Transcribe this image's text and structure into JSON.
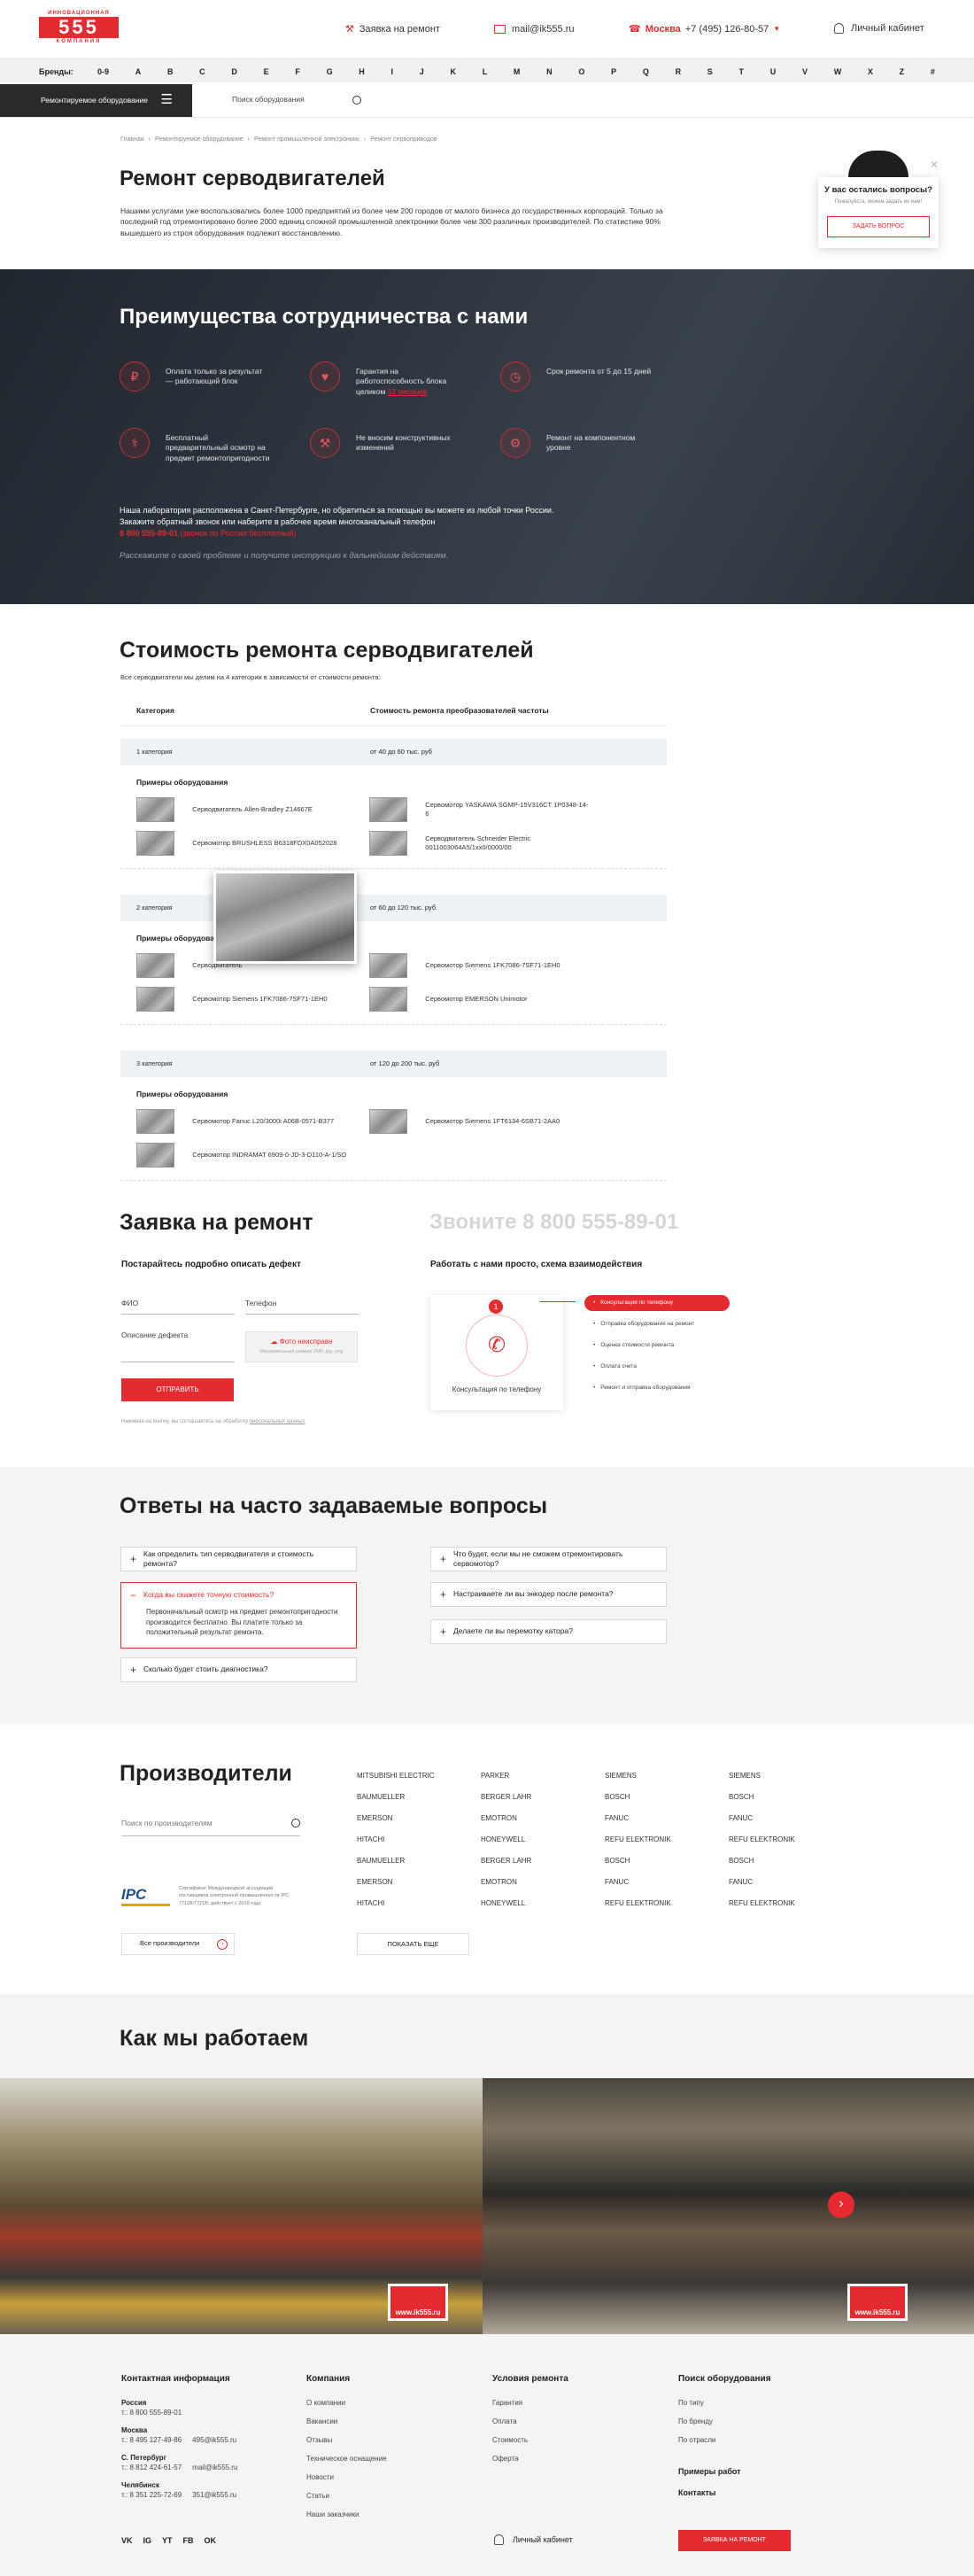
{
  "header": {
    "logo_top": "ИННОВАЦИОННАЯ",
    "logo_num": "555",
    "logo_bottom": "КОМПАНИЯ",
    "repair_link": "Заявка на ремонт",
    "email": "mail@ik555.ru",
    "city": "Москва",
    "phone": "+7 (495) 126-80-57",
    "cabinet": "Личный кабинет"
  },
  "brands": {
    "label": "Бренды:",
    "letters": [
      "0-9",
      "A",
      "B",
      "C",
      "D",
      "E",
      "F",
      "G",
      "H",
      "I",
      "J",
      "K",
      "L",
      "M",
      "N",
      "O",
      "P",
      "Q",
      "R",
      "S",
      "T",
      "U",
      "V",
      "W",
      "X",
      "Z",
      "#"
    ]
  },
  "nav": {
    "catalog": "Ремонтируемое оборудование",
    "search_placeholder": "Поиск оборудования"
  },
  "breadcrumbs": [
    "Главная",
    "Ремонтируемое оборудование",
    "Ремонт промышленной электроники",
    "Ремонт сервоприводов"
  ],
  "hero": {
    "title": "Ремонт серводвигателей",
    "text": "Нашими услугами уже воспользовались более 1000 предприятий из более чем 200 городов от малого бизнеса до государственных корпораций. Только за последний год отремонтировано более 2000 единиц сложной промышленной электроники более чем 300 различных производителей. По статистике 90% вышедшего из строя оборудования подлежит восстановлению."
  },
  "popup": {
    "title": "У вас остались вопросы?",
    "sub": "Пожалуйста, можем задать их нам!",
    "button": "ЗАДАТЬ ВОПРОС"
  },
  "advantages": {
    "title": "Преимущества сотрудничества с нами",
    "items": [
      {
        "icon": "money-icon",
        "text": "Оплата только за результат — работающий блок"
      },
      {
        "icon": "heart-icon",
        "text": "Гарантия на работоспособность блока целиком",
        "link": "12 месяцев"
      },
      {
        "icon": "clock-icon",
        "text": "Срок ремонта от 5 до 15 дней"
      },
      {
        "icon": "diagnostics-icon",
        "text": "Бесплатный предварительный осмотр на предмет ремонтопригодности"
      },
      {
        "icon": "wrench-icon",
        "text": "Не вносим конструктивных изменений"
      },
      {
        "icon": "chip-icon",
        "text": "Ремонт на компонентном уровне"
      }
    ],
    "p1": "Наша лаборатория расположена в Санкт-Петербурге, но обратиться за помощью вы можете из любой точки России.",
    "p2": "Закажите обратный звонок или наберите в рабочее время многоканальный телефон",
    "phone": "8 800 555-89-01",
    "phone_note": "(звонок по России бесплатный)",
    "note": "Расскажите о своей проблеме и получите инструкцию к дальнейшим действиям."
  },
  "pricing": {
    "title": "Стоимость ремонта серводвигателей",
    "sub": "Все серводвигатели мы делим на 4 категории в зависимости от стоимости ремонта:",
    "col1": "Категория",
    "col2": "Стоимость ремонта преобразователей частоты",
    "examples": "Примеры оборудования",
    "cats": [
      {
        "name": "1 категория",
        "price": "от 40 до 60 тыс. руб",
        "items": [
          "Серводвигатель Allen-Bradley Z14667E",
          "Сервомотор YASKAWA SGMP-15V316CT 1P0348-14-6",
          "Сервомотор BRUSHLESS B6318FDX0A052028",
          "Серводвигатель Schneider Electric 0011003064A5/1xx0/0000/00"
        ]
      },
      {
        "name": "2 категория",
        "price": "от 60 до 120 тыс. руб",
        "items": [
          "Серводвигатель",
          "Сервомотор Siemens 1FK7086-7SF71-1EH0",
          "Сервомотор Siemens 1FK7086-7SF71-1EH0",
          "Сервомотор EMERSON Unimotor"
        ]
      },
      {
        "name": "3 категория",
        "price": "от 120 до 200 тыс. руб",
        "items": [
          "Сервомотор Fanuc L20/3000i A06B-0571-B377",
          "Сервомотор Siemens 1FT6134-6SB71-2AA0",
          "Сервомотор INDRAMAT 6909-0-JD-3-D110-A-1/SO"
        ]
      }
    ]
  },
  "request": {
    "title": "Заявка на ремонт",
    "call": "Звоните 8 800 555-89-01",
    "describe": "Постарайтесь подробно описать дефект",
    "fio": "ФИО",
    "phone": "Телефон",
    "desc": "Описание дефекта",
    "photo": "Фото неисправн",
    "photo_sub": "Максимальный размер 2Мб; jpg, png",
    "submit": "ОТПРАВИТЬ",
    "consent": "Нажимая на кнопку, вы соглашаетесь на обработку",
    "consent_link": "персональных данных",
    "scheme_title": "Работать с нами просто, схема взаимодействия",
    "step_num": "1",
    "step_caption": "Консультация по телефону",
    "steps": [
      "Консультация по телефону",
      "Отправка оборудования на ремонт",
      "Оценка стоимости ремонта",
      "Оплата счета",
      "Ремонт и отправка оборудования"
    ]
  },
  "faq": {
    "title": "Ответы на часто задаваемые вопросы",
    "left": [
      "Как определить тип серводвигателя и стоимость ремонта?",
      "Когда вы скажете точную стоимость?",
      "Сколько будет стоить диагностика?"
    ],
    "open_answer": "Первоначальный осмотр на предмет ремонтопригодности производится бесплатно. Вы платите только за положительный результат ремонта.",
    "right": [
      "Что будет, если мы не сможем отремонтировать сервомотор?",
      "Настраиваете ли вы энкодер после ремонта?",
      "Делаете ли вы перемотку катора?"
    ]
  },
  "makers": {
    "title": "Производители",
    "search_placeholder": "Поиск по производителям",
    "ipc_text": "Сертификат Международной ассоциации поставщиков электронной промышленности IPC-7711B/7721B, действует с 2016 года",
    "ipc_logo": "IPC",
    "all": "Все производители",
    "more": "ПОКАЗАТЬ ЕЩЕ",
    "cols": [
      [
        "MITSUBISHI ELECTRIC",
        "BAUMUELLER",
        "EMERSON",
        "HITACHI",
        "BAUMUELLER",
        "EMERSON",
        "HITACHI"
      ],
      [
        "PARKER",
        "BERGER LAHR",
        "EMOTRON",
        "HONEYWELL",
        "BERGER LAHR",
        "EMOTRON",
        "HONEYWELL"
      ],
      [
        "SIEMENS",
        "BOSCH",
        "FANUC",
        "REFU ELEKTRONIK",
        "BOSCH",
        "FANUC",
        "REFU ELEKTRONIK"
      ],
      [
        "SIEMENS",
        "BOSCH",
        "FANUC",
        "REFU ELEKTRONIK",
        "BOSCH",
        "FANUC",
        "REFU ELEKTRONIK"
      ]
    ]
  },
  "how": {
    "title": "Как мы работаем",
    "watermark": "www.ik555.ru"
  },
  "footer": {
    "contacts_title": "Контактная информация",
    "cities": [
      {
        "city": "Россия",
        "lines": [
          "т.: 8 800 555-89-01"
        ]
      },
      {
        "city": "Москва",
        "lines": [
          "т.: 8 495 127-49-86",
          "495@ik555.ru"
        ]
      },
      {
        "city": "С. Петербург",
        "lines": [
          "т.: 8 812 424-61-57",
          "mail@ik555.ru"
        ]
      },
      {
        "city": "Челябинск",
        "lines": [
          "т.: 8 351 225-72-69",
          "351@ik555.ru"
        ]
      }
    ],
    "company_title": "Компания",
    "company": [
      "О компании",
      "Вакансии",
      "Отзывы",
      "Техническое оснащение",
      "Новости",
      "Статьи",
      "Наши заказчики"
    ],
    "repair_title": "Условия ремонта",
    "repair": [
      "Гарантия",
      "Оплата",
      "Стоимость",
      "Оферта"
    ],
    "search_title": "Поиск оборудования",
    "search": [
      "По типу",
      "По бренду",
      "По отрасли"
    ],
    "examples": "Примеры работ",
    "contacts": "Контакты",
    "cabinet": "Личный кабинет",
    "cta": "ЗАЯВКА НА РЕМОНТ",
    "socials": [
      "VK",
      "IG",
      "YT",
      "FB",
      "OK"
    ]
  }
}
